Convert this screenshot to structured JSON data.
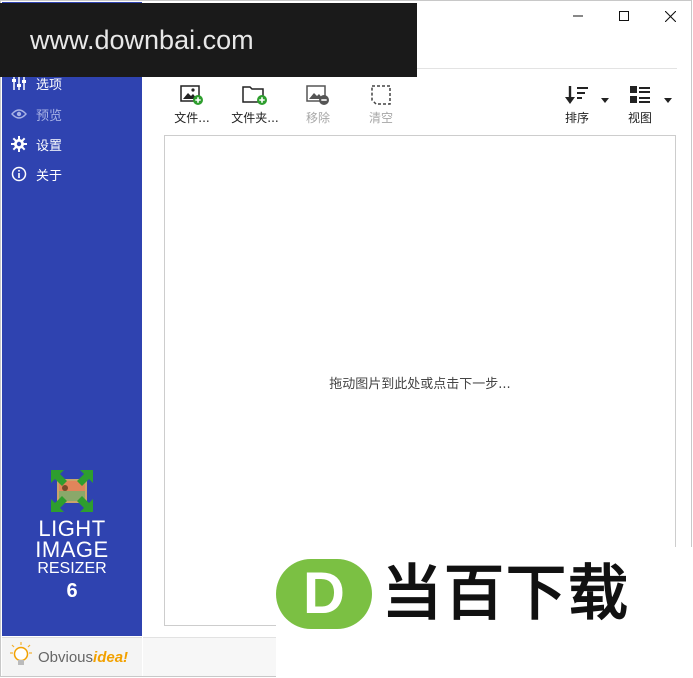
{
  "watermark_top": "www.downbai.com",
  "sidebar": {
    "items": [
      {
        "label": "选项",
        "icon": "sliders-icon"
      },
      {
        "label": "预览",
        "icon": "eye-icon"
      },
      {
        "label": "设置",
        "icon": "gear-icon"
      },
      {
        "label": "关于",
        "icon": "info-icon"
      }
    ],
    "logo": {
      "line1": "LIGHT",
      "line2": "IMAGE",
      "line3": "RESIZER",
      "line4": "6"
    },
    "brand": {
      "part1": "Obvious",
      "part2": "idea!"
    }
  },
  "toolbar": {
    "files": "文件...",
    "folder": "文件夹...",
    "remove": "移除",
    "clear": "清空",
    "sort": "排序",
    "view": "视图"
  },
  "dropzone": {
    "message": "拖动图片到此处或点击下一步..."
  },
  "watermark_bottom": {
    "d": "D",
    "text": "当百下载"
  },
  "colors": {
    "sidebar": "#2f43b0",
    "accent_green": "#2e9e2e",
    "watermark_green": "#7bc043"
  }
}
